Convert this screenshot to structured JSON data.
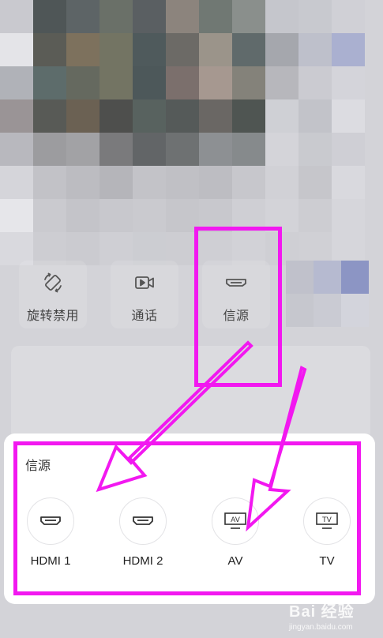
{
  "colors": {
    "annotation": "#f218f0",
    "sheet_bg": "#ffffff",
    "text": "#333333"
  },
  "quick_tiles": [
    {
      "label": "旋转禁用",
      "icon": "rotate-icon"
    },
    {
      "label": "通话",
      "icon": "video-call-icon"
    },
    {
      "label": "信源",
      "icon": "hdmi-icon"
    }
  ],
  "source_panel": {
    "title": "信源",
    "items": [
      {
        "label": "HDMI 1",
        "icon": "hdmi-icon"
      },
      {
        "label": "HDMI 2",
        "icon": "hdmi-icon"
      },
      {
        "label": "AV",
        "icon": "av-icon",
        "icon_text": "AV"
      },
      {
        "label": "TV",
        "icon": "tv-icon",
        "icon_text": "TV"
      }
    ]
  },
  "watermark": {
    "main": "Bai  经验",
    "sub": "jingyan.baidu.com"
  }
}
